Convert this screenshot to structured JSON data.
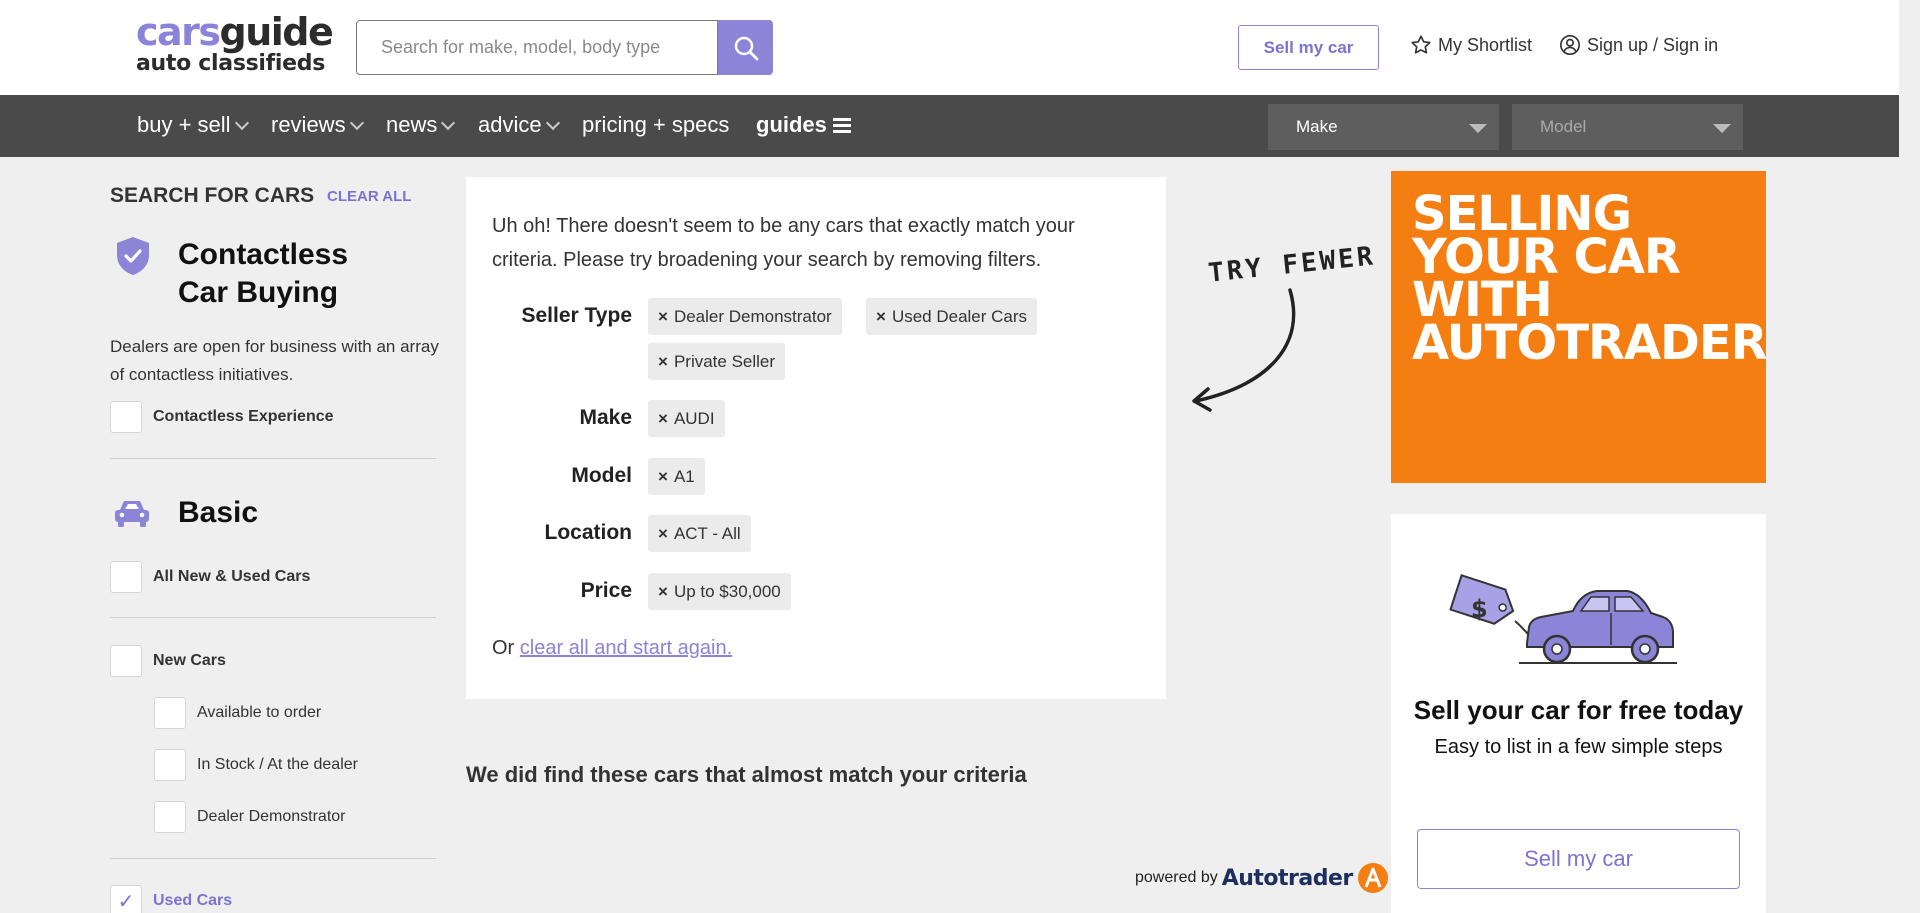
{
  "header": {
    "logo_cars": "cars",
    "logo_guide": "guide",
    "logo_sub": "auto classifieds",
    "search_placeholder": "Search for make, model, body type",
    "sell_button": "Sell my car",
    "shortlist": "My Shortlist",
    "signin": "Sign up / Sign in"
  },
  "nav": {
    "items": [
      "buy + sell",
      "reviews",
      "news",
      "advice",
      "pricing + specs",
      "guides"
    ],
    "make_select": "Make",
    "model_select": "Model"
  },
  "sidebar": {
    "title": "SEARCH FOR CARS",
    "clear_all": "CLEAR ALL",
    "contactless_heading_1": "Contactless",
    "contactless_heading_2": "Car Buying",
    "contactless_desc": "Dealers are open for business with an array of contactless initiatives.",
    "contactless_option": "Contactless Experience",
    "basic_heading": "Basic",
    "options": {
      "all": "All New & Used Cars",
      "new": "New Cars",
      "available": "Available to order",
      "in_stock": "In Stock / At the dealer",
      "demonstrator": "Dealer Demonstrator",
      "used": "Used Cars"
    },
    "check_mark": "✓"
  },
  "results": {
    "message": "Uh oh! There doesn't seem to be any cars that exactly match your criteria. Please try broadening your search by removing filters.",
    "filters": {
      "seller_type_label": "Seller Type",
      "seller_type_chips": [
        "Dealer Demonstrator",
        "Used Dealer Cars",
        "Private Seller"
      ],
      "make_label": "Make",
      "make_chip": "AUDI",
      "model_label": "Model",
      "model_chip": "A1",
      "location_label": "Location",
      "location_chip": "ACT - All",
      "price_label": "Price",
      "price_chip": "Up to $30,000"
    },
    "chip_x": "×",
    "or_text": "Or",
    "clear_link": "clear all and start again.",
    "try_fewer": "TRY FEWER",
    "almost_heading": "We did find these cars that almost match your criteria",
    "powered_by": "powered by",
    "powered_brand": "Autotrader"
  },
  "ad": {
    "text": "SELLING YOUR CAR WITH AUTOTRADER",
    "bg_color": "#f57e12"
  },
  "sell_card": {
    "heading": "Sell your car for free today",
    "subheading": "Easy to list in a few simple steps",
    "button": "Sell my car",
    "tag_symbol": "$"
  },
  "colors": {
    "accent": "#8c84d6",
    "nav_bg": "#4a4a4a",
    "page_bg": "#efefef"
  }
}
